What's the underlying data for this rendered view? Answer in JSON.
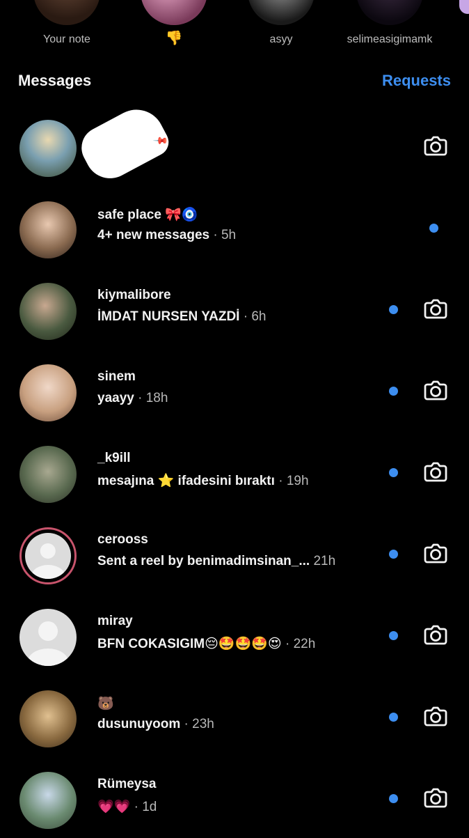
{
  "notes": [
    {
      "label": "Your note"
    },
    {
      "label": "👎"
    },
    {
      "label": "asyy"
    },
    {
      "label": "selimeasigimamk"
    }
  ],
  "header": {
    "title": "Messages",
    "requests_label": "Requests"
  },
  "threads": [
    {
      "name": "",
      "preview": "",
      "time": "",
      "unread": false,
      "pinned": true,
      "avatar": "photo"
    },
    {
      "name": "safe place 🎀🧿",
      "preview": "4+ new messages",
      "time": "5h",
      "unread": true,
      "camera": false,
      "avatar": "photo"
    },
    {
      "name": "kiymalibore",
      "preview": "İMDAT NURSEN YAZDİ",
      "time": "6h",
      "unread": true,
      "camera": true,
      "avatar": "photo"
    },
    {
      "name": "sinem",
      "preview": "yaayy",
      "time": "18h",
      "unread": true,
      "camera": true,
      "avatar": "photo"
    },
    {
      "name": "_k9ill",
      "preview": "mesajına ⭐ ifadesini bıraktı",
      "time": "19h",
      "unread": true,
      "camera": true,
      "avatar": "photo"
    },
    {
      "name": "cerooss",
      "preview": "Sent a reel by benimadimsinan_...",
      "time": "21h",
      "unread": true,
      "camera": true,
      "avatar": "default-ring"
    },
    {
      "name": "miray",
      "preview": "BFN COKASIGIM😔🤩🤩🤩😍",
      "time": "22h",
      "unread": true,
      "camera": true,
      "avatar": "default"
    },
    {
      "name": "🐻",
      "preview": "dusunuyoom",
      "time": "23h",
      "unread": true,
      "camera": true,
      "avatar": "photo"
    },
    {
      "name": "Rümeysa",
      "preview": "💗💗",
      "time": "1d",
      "unread": true,
      "camera": true,
      "avatar": "photo"
    }
  ],
  "colors": {
    "accent": "#3d8ef0",
    "background": "#000000",
    "story_ring": "#c8546c"
  },
  "icons": {
    "camera": "camera-icon",
    "pin": "pin-icon",
    "unread": "unread-dot"
  }
}
